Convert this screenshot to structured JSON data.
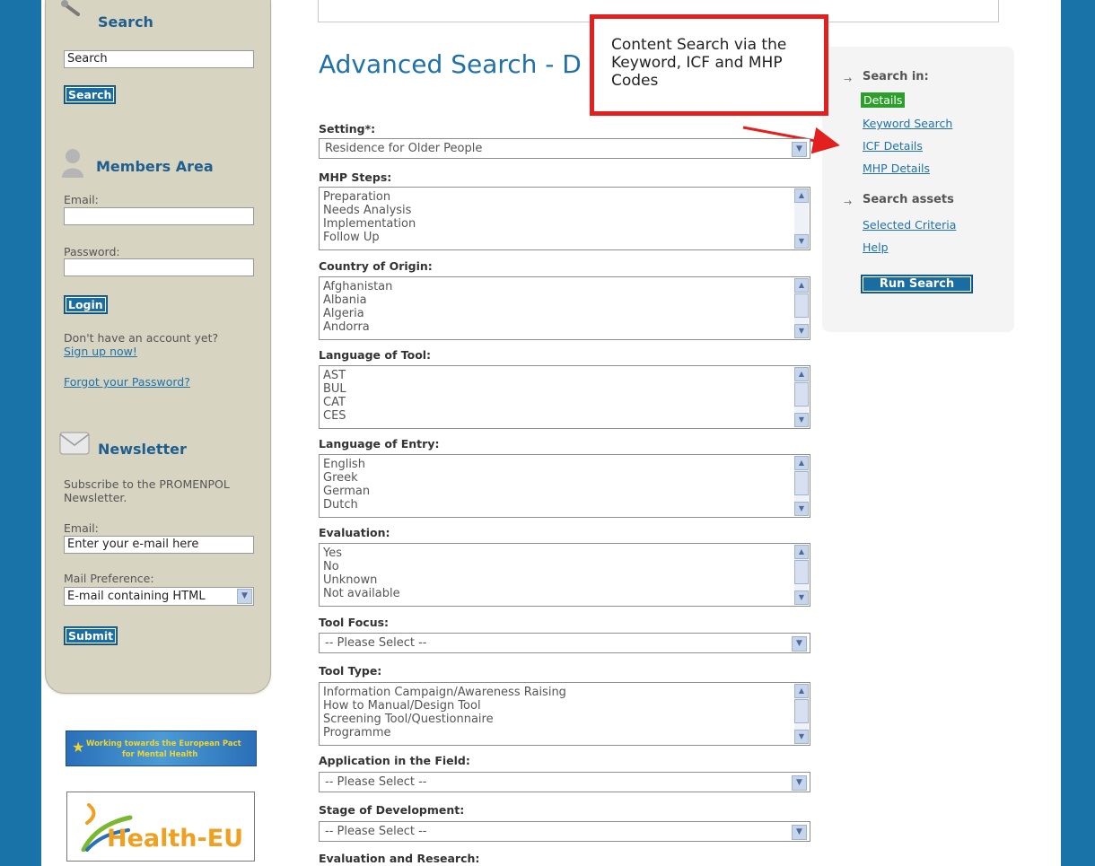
{
  "sidebar": {
    "search": {
      "heading": "Search",
      "input_value": "Search",
      "button": "Search"
    },
    "members": {
      "heading": "Members Area",
      "email_label": "Email:",
      "password_label": "Password:",
      "login_button": "Login",
      "no_account_text": "Don't have an account yet?",
      "signup_link": "Sign up now!",
      "forgot_link": "Forgot your Password?"
    },
    "newsletter": {
      "heading": "Newsletter",
      "subscribe_text_1": "Subscribe to the PROMENPOL",
      "subscribe_text_2": "Newsletter.",
      "email_label": "Email:",
      "email_placeholder": "Enter your e-mail here",
      "pref_label": "Mail Preference:",
      "pref_value": "E-mail containing HTML",
      "submit_button": "Submit"
    },
    "banner_pact_1": "Working towards the European Pact",
    "banner_pact_2": "for Mental Health",
    "banner_health": "Health-EU"
  },
  "main": {
    "title": "Advanced Search - D",
    "fields": [
      {
        "label": "Setting*:",
        "type": "select",
        "value": "Residence for Older People"
      },
      {
        "label": "MHP Steps:",
        "type": "list",
        "options": [
          "Preparation",
          "Needs Analysis",
          "Implementation",
          "Follow Up"
        ]
      },
      {
        "label": "Country of Origin:",
        "type": "list",
        "options": [
          "Afghanistan",
          "Albania",
          "Algeria",
          "Andorra"
        ]
      },
      {
        "label": "Language of Tool:",
        "type": "list",
        "options": [
          "AST",
          "BUL",
          "CAT",
          "CES"
        ]
      },
      {
        "label": "Language of Entry:",
        "type": "list",
        "options": [
          "English",
          "Greek",
          "German",
          "Dutch"
        ]
      },
      {
        "label": "Evaluation:",
        "type": "list",
        "options": [
          "Yes",
          "No",
          "Unknown",
          "Not available"
        ]
      },
      {
        "label": "Tool Focus:",
        "type": "select",
        "value": "-- Please Select --"
      },
      {
        "label": "Tool Type:",
        "type": "list",
        "options": [
          "Information Campaign/Awareness Raising",
          "How to Manual/Design Tool",
          "Screening Tool/Questionnaire",
          "Programme"
        ]
      },
      {
        "label": "Application in the Field:",
        "type": "select",
        "value": "-- Please Select --"
      },
      {
        "label": "Stage of Development:",
        "type": "select",
        "value": "-- Please Select --"
      },
      {
        "label": "Evaluation and Research:",
        "type": "label"
      }
    ]
  },
  "right_panel": {
    "search_in_heading": "Search in:",
    "search_in_items": [
      "Details",
      "Keyword Search",
      "ICF Details",
      "MHP Details"
    ],
    "assets_heading": "Search assets",
    "assets_items": [
      "Selected Criteria",
      "Help"
    ],
    "run_button": "Run Search"
  },
  "callout": {
    "text": "Content Search via the Keyword, ICF and MHP Codes",
    "border_color": "#e3201e"
  },
  "colors": {
    "accent_blue": "#1f72a8",
    "frame_blue": "#1a73a8",
    "active_green": "#2aa02a"
  }
}
